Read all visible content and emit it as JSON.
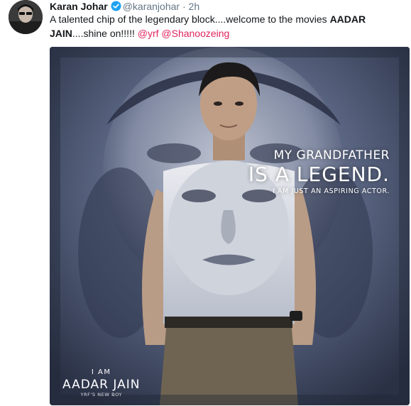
{
  "tweet": {
    "author_name": "Karan Johar",
    "author_handle": "@karanjohar",
    "separator": "·",
    "timestamp": "2h",
    "verified_icon": "verified-badge-icon",
    "text_part1": "A talented chip of the legendary block....welcome to the movies ",
    "text_bold1": "AADAR",
    "text_bold2": "JAIN",
    "text_part2": "....shine on!!!!! ",
    "mention1": "@yrf",
    "mention2": "@Shanoozeing",
    "mention_color": "#e0245e",
    "verified_color": "#1da1f2"
  },
  "poster": {
    "tagline_line1": "MY GRANDFATHER",
    "tagline_line2": "IS A LEGEND.",
    "tagline_line3": "I AM JUST AN ASPIRING ACTOR.",
    "credit_line1": "I AM",
    "credit_line2": "AADAR JAIN",
    "credit_line3": "YRF'S NEW BOY",
    "background_color": "#45506a"
  }
}
